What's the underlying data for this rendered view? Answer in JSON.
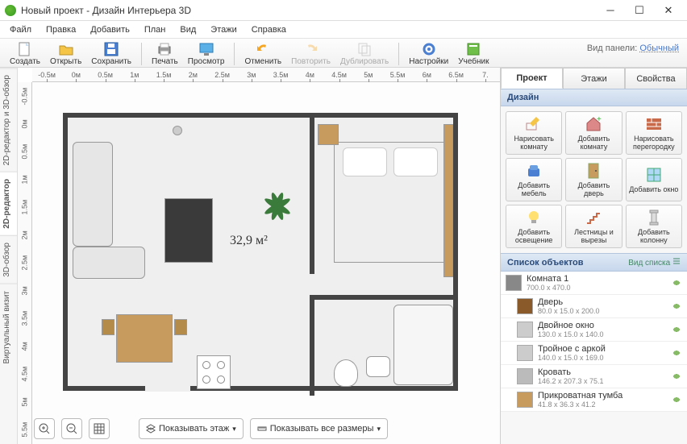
{
  "titlebar": {
    "title": "Новый проект - Дизайн Интерьера 3D"
  },
  "menu": [
    "Файл",
    "Правка",
    "Добавить",
    "План",
    "Вид",
    "Этажи",
    "Справка"
  ],
  "toolbar": {
    "create": "Создать",
    "open": "Открыть",
    "save": "Сохранить",
    "print": "Печать",
    "view": "Просмотр",
    "undo": "Отменить",
    "redo": "Повторить",
    "duplicate": "Дублировать",
    "settings": "Настройки",
    "help": "Учебник"
  },
  "panel_mode": {
    "label": "Вид панели:",
    "value": "Обычный"
  },
  "lefttabs": {
    "combo": "2D-редактор и 3D-обзор",
    "twod": "2D-редактор",
    "threed": "3D-обзор",
    "virtual": "Виртуальный визит"
  },
  "ruler_h": [
    "-0.5м",
    "0м",
    "0.5м",
    "1м",
    "1.5м",
    "2м",
    "2.5м",
    "3м",
    "3.5м",
    "4м",
    "4.5м",
    "5м",
    "5.5м",
    "6м",
    "6.5м",
    "7."
  ],
  "ruler_v": [
    "-0.5м",
    "0м",
    "0.5м",
    "1м",
    "1.5м",
    "2м",
    "2.5м",
    "3м",
    "3.5м",
    "4м",
    "4.5м",
    "5м",
    "5.5м"
  ],
  "area_label": "32,9 м²",
  "bottombar": {
    "show_floor": "Показывать этаж",
    "show_all": "Показывать все размеры"
  },
  "rtabs": {
    "project": "Проект",
    "floors": "Этажи",
    "props": "Свойства"
  },
  "rsection_design": "Дизайн",
  "tools": {
    "draw_room": "Нарисовать комнату",
    "add_room": "Добавить комнату",
    "draw_partition": "Нарисовать перегородку",
    "add_furniture": "Добавить мебель",
    "add_door": "Добавить дверь",
    "add_window": "Добавить окно",
    "add_light": "Добавить освещение",
    "stairs": "Лестницы и вырезы",
    "add_column": "Добавить колонну"
  },
  "rsection_objects": "Список объектов",
  "viewlink": "Вид списка",
  "objects": [
    {
      "name": "Комната 1",
      "dims": "700.0 x 470.0",
      "icon": "room",
      "indent": 0
    },
    {
      "name": "Дверь",
      "dims": "80.0 x 15.0 x 200.0",
      "icon": "door",
      "indent": 1
    },
    {
      "name": "Двойное окно",
      "dims": "130.0 x 15.0 x 140.0",
      "icon": "window",
      "indent": 1
    },
    {
      "name": "Тройное с аркой",
      "dims": "140.0 x 15.0 x 169.0",
      "icon": "window",
      "indent": 1
    },
    {
      "name": "Кровать",
      "dims": "146.2 x 207.3 x 75.1",
      "icon": "bed",
      "indent": 1
    },
    {
      "name": "Прикроватная тумба",
      "dims": "41.8 x 36.3 x 41.2",
      "icon": "table",
      "indent": 1
    }
  ]
}
